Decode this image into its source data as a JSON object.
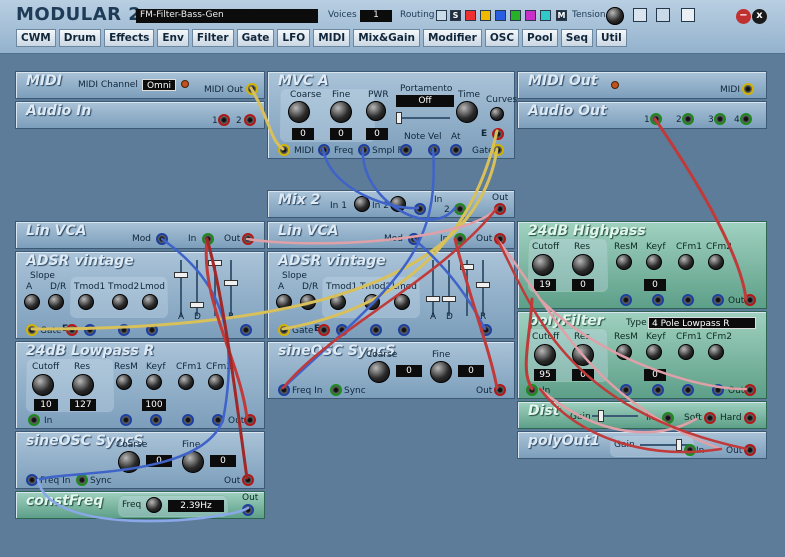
{
  "app": {
    "title": "MODULAR 2",
    "patch_name": "FM-Filter-Bass-Gen",
    "voices_label": "Voices",
    "voices": "1",
    "routing_label": "Routing",
    "routing_s": "S",
    "routing_m": "M",
    "tension_label": "Tension"
  },
  "tabs": [
    "CWM",
    "Drum",
    "Effects",
    "Env",
    "Filter",
    "Gate",
    "LFO",
    "MIDI",
    "Mix&Gain",
    "Modifier",
    "OSC",
    "Pool",
    "Seq",
    "Util"
  ],
  "colors": {
    "background": "#5d7c99",
    "module": "#9bb7cf",
    "module_green": "#7fbba6",
    "cable_red": "#c03a3a",
    "cable_blue": "#3f63c8",
    "cable_yellow": "#d8c05a",
    "cable_pink": "#e0a0a8"
  },
  "modules": {
    "midi": {
      "name": "MIDI",
      "channel_label": "MIDI Channel",
      "channel": "Omni",
      "out": "MIDI Out"
    },
    "audio_in": {
      "name": "Audio In",
      "p1": "1",
      "p2": "2"
    },
    "mvca": {
      "name": "MVC A",
      "coarse": "Coarse",
      "fine": "Fine",
      "pwr": "PWR",
      "portamento": "Portamento",
      "porta_value": "Off",
      "time": "Time",
      "curves": "Curves",
      "coarse_val": "0",
      "fine_val": "0",
      "pwr_val": "0",
      "midi": "MIDI",
      "freq": "Freq",
      "smpl": "Smpl F",
      "note": "Note",
      "vel": "Vel",
      "at": "At",
      "e": "E",
      "gate": "Gate"
    },
    "midi_out": {
      "name": "MIDI Out",
      "midi": "MIDI"
    },
    "audio_out": {
      "name": "Audio Out",
      "p1": "1",
      "p2": "2",
      "p3": "3",
      "p4": "4"
    },
    "mix2": {
      "name": "Mix 2",
      "in1": "In 1",
      "in2": "In 2",
      "in": "In",
      "two": "2",
      "out": "Out"
    },
    "linvca1": {
      "name": "Lin VCA",
      "mod": "Mod",
      "in": "In",
      "out": "Out"
    },
    "linvca2": {
      "name": "Lin VCA"
    },
    "adsr1": {
      "name": "ADSR vintage",
      "slope": "Slope",
      "a": "A",
      "dr": "D/R",
      "tmod1": "Tmod1",
      "tmod2": "Tmod2",
      "lmod": "Lmod",
      "sa": "A",
      "sd": "D",
      "sr": "R",
      "gate": "Gate",
      "e": "E"
    },
    "adsr2": {
      "name": "ADSR vintage",
      "slope": "Slope",
      "a": "A",
      "dr": "D/R",
      "tmod1": "Tmod1",
      "tmod2": "Tmod2",
      "lmod": "Lmod",
      "sa": "A",
      "sd": "D",
      "sr": "R",
      "gate": "Gate",
      "e": "E"
    },
    "lowpass": {
      "name": "24dB Lowpass R",
      "cutoff": "Cutoff",
      "res": "Res",
      "resm": "ResM",
      "keyf": "Keyf",
      "cfm1": "CFm1",
      "cfm2": "CFm2",
      "cutoff_val": "10",
      "res_val": "127",
      "keyf_val": "100",
      "in": "In",
      "out": "Out"
    },
    "sine1": {
      "name": "sineOSC SyncS",
      "coarse": "Coarse",
      "fine": "Fine",
      "coarse_val": "0",
      "fine_val": "0",
      "freqin": "Freq In",
      "sync": "Sync",
      "out": "Out"
    },
    "sine2": {
      "name": "sineOSC SyncS",
      "coarse": "Coarse",
      "fine": "Fine",
      "coarse_val": "0",
      "fine_val": "0",
      "freqin": "Freq In",
      "sync": "Sync",
      "out": "Out"
    },
    "constfreq": {
      "name": "constFreq",
      "freq": "Freq",
      "value": "2.39Hz",
      "out": "Out"
    },
    "highpass": {
      "name": "24dB Highpass",
      "cutoff": "Cutoff",
      "res": "Res",
      "resm": "ResM",
      "keyf": "Keyf",
      "cfm1": "CFm1",
      "cfm2": "CFm2",
      "cutoff_val": "19",
      "res_val": "0",
      "keyf_val": "0",
      "in": "In",
      "out": "Out"
    },
    "polyfilter": {
      "name": "polyFilter",
      "type_label": "Type",
      "type": "4 Pole Lowpass R",
      "cutoff": "Cutoff",
      "res": "Res",
      "resm": "ResM",
      "keyf": "Keyf",
      "cfm1": "CFm1",
      "cfm2": "CFm2",
      "cutoff_val": "95",
      "res_val": "0",
      "keyf_val": "0",
      "in": "In",
      "out": "Out"
    },
    "dist": {
      "name": "Dist",
      "gain": "Gain",
      "in": "In",
      "soft": "Soft",
      "hard": "Hard"
    },
    "polyout": {
      "name": "polyOut1",
      "gain": "Gain",
      "in": "In",
      "out": "Out"
    }
  }
}
